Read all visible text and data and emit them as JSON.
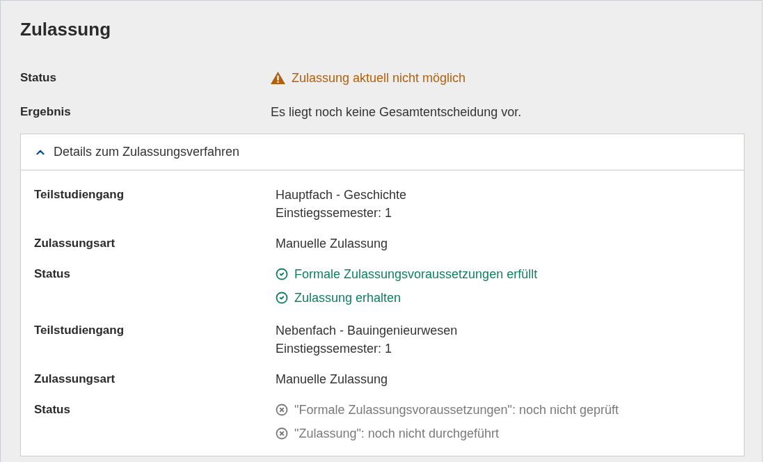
{
  "title": "Zulassung",
  "summary": [
    {
      "label": "Status",
      "kind": "warning",
      "value": "Zulassung aktuell nicht möglich"
    },
    {
      "label": "Ergebnis",
      "kind": "text",
      "value": "Es liegt noch keine Gesamtentscheidung vor."
    }
  ],
  "details": {
    "header": "Details zum Zulassungsverfahren",
    "expanded": true,
    "rows": [
      {
        "label": "Teilstudiengang",
        "kind": "lines",
        "lines": [
          "Hauptfach - Geschichte",
          "Einstiegssemester: 1"
        ]
      },
      {
        "label": "Zulassungsart",
        "kind": "lines",
        "lines": [
          "Manuelle Zulassung"
        ]
      },
      {
        "label": "Status",
        "kind": "statuses",
        "statuses": [
          {
            "text": "Formale Zulassungsvoraussetzungen erfüllt",
            "fulfilled": true
          },
          {
            "text": "Zulassung erhalten",
            "fulfilled": true
          }
        ]
      },
      {
        "label": "Teilstudiengang",
        "kind": "lines",
        "lines": [
          "Nebenfach - Bauingenieurwesen",
          "Einstiegssemester: 1"
        ]
      },
      {
        "label": "Zulassungsart",
        "kind": "lines",
        "lines": [
          "Manuelle Zulassung"
        ]
      },
      {
        "label": "Status",
        "kind": "statuses",
        "statuses": [
          {
            "text": "\"Formale Zulassungsvoraussetzungen\": noch nicht geprüft",
            "fulfilled": false
          },
          {
            "text": "\"Zulassung\": noch nicht durchgeführt",
            "fulfilled": false
          }
        ]
      }
    ]
  }
}
